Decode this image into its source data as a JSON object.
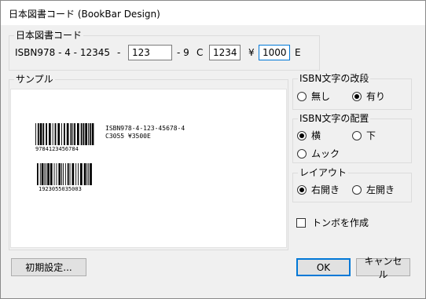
{
  "window": {
    "title": "日本図書コード (BookBar Design)"
  },
  "code_group": {
    "label": "日本図書コード",
    "prefix": "ISBN978 - 4 - 12345",
    "dash1": "-",
    "field1": "123",
    "dash2": "- 9",
    "c_label": "C",
    "field2": "1234",
    "yen_label": "¥",
    "field3": "1000",
    "e_label": "E"
  },
  "sample": {
    "label": "サンプル",
    "isbn_text": "ISBN978-4-123-45678-4",
    "c_text": "C3055 ¥3500E",
    "barcode1_digits": "9784123456784",
    "barcode2_digits": "1923055035003"
  },
  "linebreak_group": {
    "label": "ISBN文字の改段",
    "options": [
      "無し",
      "有り"
    ],
    "selected": "有り"
  },
  "placement_group": {
    "label": "ISBN文字の配置",
    "options": [
      "横",
      "下",
      "ムック"
    ],
    "selected": "横"
  },
  "layout_group": {
    "label": "レイアウト",
    "options": [
      "右開き",
      "左開き"
    ],
    "selected": "右開き"
  },
  "tombo": {
    "label": "トンボを作成",
    "checked": false
  },
  "buttons": {
    "initial": "初期設定...",
    "ok": "OK",
    "cancel": "キャンセル"
  }
}
